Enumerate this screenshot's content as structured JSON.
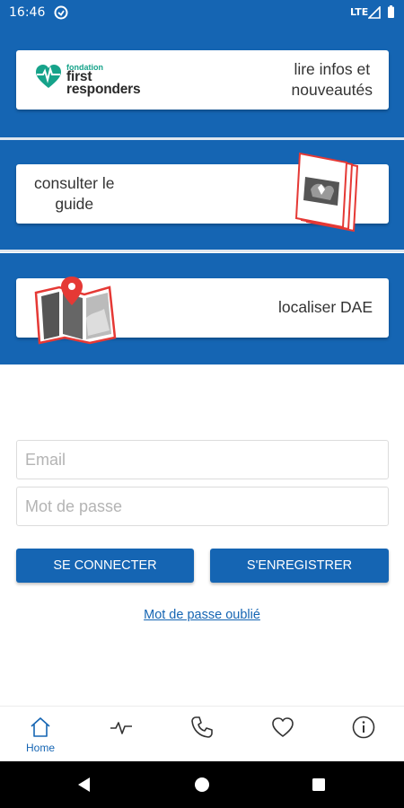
{
  "status_bar": {
    "time": "16:46",
    "network": "LTE"
  },
  "cards": {
    "news": {
      "logo_small": "fondation",
      "logo_line1": "first",
      "logo_line2": "responders",
      "label_line1": "lire infos et",
      "label_line2": "nouveautés"
    },
    "guide": {
      "label_line1": "consulter le",
      "label_line2": "guide"
    },
    "aed": {
      "label": "localiser DAE"
    }
  },
  "form": {
    "email_placeholder": "Email",
    "password_placeholder": "Mot de passe",
    "connect_label": "SE CONNECTER",
    "register_label": "S'ENREGISTRER",
    "forgot_label": "Mot de passe oublié"
  },
  "tabs": [
    {
      "icon": "home-icon",
      "label": "Home",
      "active": true
    },
    {
      "icon": "heartbeat-icon",
      "label": ""
    },
    {
      "icon": "phone-icon",
      "label": ""
    },
    {
      "icon": "heart-icon",
      "label": ""
    },
    {
      "icon": "info-icon",
      "label": ""
    }
  ],
  "colors": {
    "primary": "#1565b3",
    "accent_red": "#e53935",
    "logo_green": "#16a38a"
  }
}
